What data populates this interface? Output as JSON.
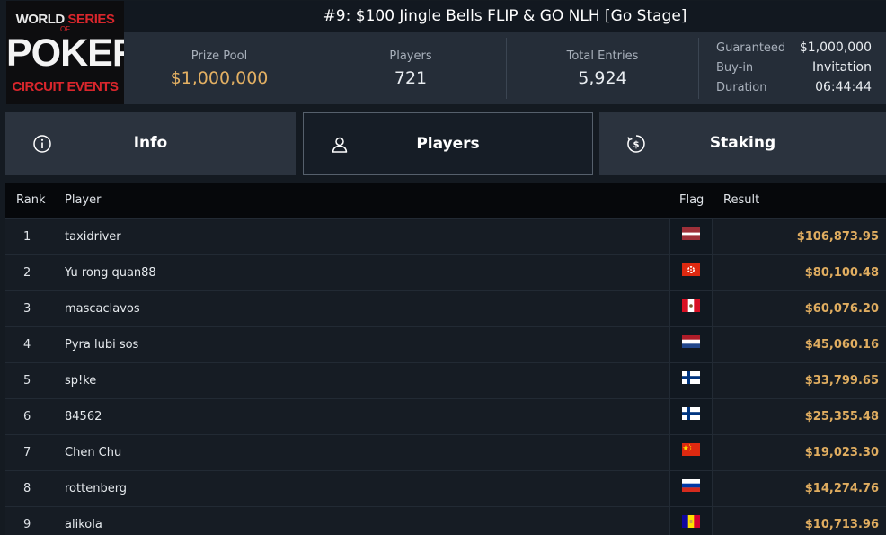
{
  "logo": {
    "line1_a": "WORLD",
    "line1_b": "SERIES",
    "line2": "OF",
    "line3": "POKER",
    "line4": "CIRCUIT EVENTS"
  },
  "tournament": {
    "title": "#9: $100 Jingle Bells FLIP & GO NLH [Go Stage]"
  },
  "stats": {
    "prize_pool_label": "Prize Pool",
    "prize_pool": "$1,000,000",
    "players_label": "Players",
    "players": "721",
    "entries_label": "Total Entries",
    "entries": "5,924"
  },
  "meta": {
    "guaranteed_label": "Guaranteed",
    "guaranteed": "$1,000,000",
    "buyin_label": "Buy-in",
    "buyin": "Invitation",
    "duration_label": "Duration",
    "duration": "06:44:44"
  },
  "tabs": [
    {
      "label": "Info",
      "icon": "info-icon",
      "active": false
    },
    {
      "label": "Players",
      "icon": "user-icon",
      "active": true
    },
    {
      "label": "Staking",
      "icon": "staking-icon",
      "active": false
    }
  ],
  "table": {
    "headers": {
      "rank": "Rank",
      "player": "Player",
      "flag": "Flag",
      "result": "Result"
    },
    "rows": [
      {
        "rank": "1",
        "player": "taxidriver",
        "flag": "latvia-flag",
        "result": "$106,873.95"
      },
      {
        "rank": "2",
        "player": "Yu rong quan88",
        "flag": "hong-kong-flag",
        "result": "$80,100.48"
      },
      {
        "rank": "3",
        "player": "mascaclavos",
        "flag": "peru-flag",
        "result": "$60,076.20"
      },
      {
        "rank": "4",
        "player": "Pyra lubi sos",
        "flag": "netherlands-flag",
        "result": "$45,060.16"
      },
      {
        "rank": "5",
        "player": "sp!ke",
        "flag": "finland-flag",
        "result": "$33,799.65"
      },
      {
        "rank": "6",
        "player": "84562",
        "flag": "finland-flag",
        "result": "$25,355.48"
      },
      {
        "rank": "7",
        "player": "Chen Chu",
        "flag": "china-flag",
        "result": "$19,023.30"
      },
      {
        "rank": "8",
        "player": "rottenberg",
        "flag": "russia-flag",
        "result": "$14,274.76"
      },
      {
        "rank": "9",
        "player": "alikola",
        "flag": "andorra-flag",
        "result": "$10,713.96"
      }
    ]
  },
  "colors": {
    "accent_gold": "#e3b063",
    "result_gold": "#e0ad60",
    "brand_red": "#d9262c"
  }
}
